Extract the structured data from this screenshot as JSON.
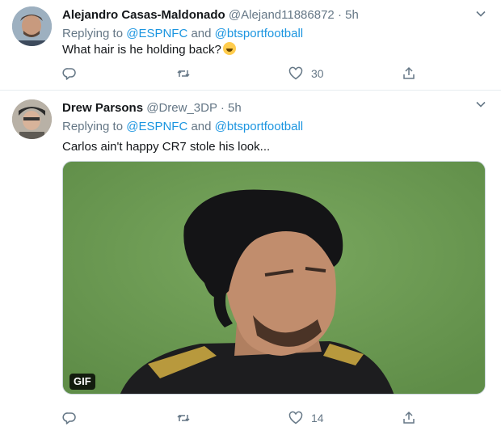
{
  "tweets": [
    {
      "name": "Alejandro Casas-Maldonado",
      "handle": "@Alejand11886872",
      "dot": " · ",
      "time": "5h",
      "replying_prefix": "Replying to ",
      "replying_user1": "@ESPNFC",
      "replying_and": " and ",
      "replying_user2": "@btsportfootball",
      "text": "What hair is he holding back?",
      "emoji": "rolling-on-floor-laughing-emoji",
      "like_count": "30"
    },
    {
      "name": "Drew Parsons",
      "handle": "@Drew_3DP",
      "dot": " · ",
      "time": "5h",
      "replying_prefix": "Replying to ",
      "replying_user1": "@ESPNFC",
      "replying_and": " and ",
      "replying_user2": "@btsportfootball",
      "text": "Carlos ain't happy CR7 stole his look...",
      "media_badge": "GIF",
      "like_count": "14"
    }
  ],
  "icons": {
    "reply": "reply-icon",
    "retweet": "retweet-icon",
    "like": "heart-icon",
    "share": "share-icon",
    "more": "chevron-down-icon"
  },
  "colors": {
    "link": "#1b95e0",
    "secondary_text": "#657786",
    "divider": "#e6ecf0"
  }
}
